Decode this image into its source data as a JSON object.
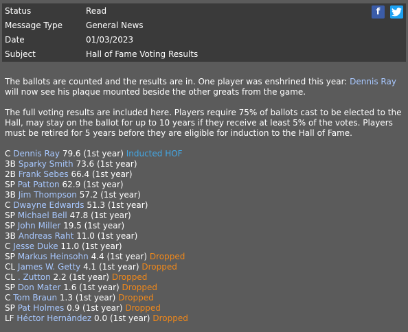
{
  "header": {
    "rows": [
      {
        "key": "Status",
        "value": "Read"
      },
      {
        "key": "Message Type",
        "value": "General News"
      },
      {
        "key": "Date",
        "value": "01/03/2023"
      },
      {
        "key": "Subject",
        "value": "Hall of Fame Voting Results"
      }
    ],
    "facebook_glyph": "f",
    "twitter_glyph": "t"
  },
  "message": {
    "p1_prefix": "The ballots are counted and the results are in. One player was enshrined this year: ",
    "p1_link": "Dennis Ray",
    "p1_suffix": " will now see his plaque mounted beside the other greats from the game.",
    "p2": "The full voting results are included here. Players require 75% of ballots cast to be elected to the Hall, may stay on the ballot for up to 10 years if they receive at least 5% of the votes.  Players must be retired for 5 years before they are eligible for induction to the Hall of Fame."
  },
  "players": [
    {
      "pos": "C",
      "name": "Dennis Ray",
      "stat": "79.6 (1st year)",
      "status": "Inducted HOF",
      "status_type": "hof"
    },
    {
      "pos": "3B",
      "name": "Sparky Smith",
      "stat": "73.6 (1st year)",
      "status": "",
      "status_type": ""
    },
    {
      "pos": "2B",
      "name": "Frank Sebes",
      "stat": "66.4 (1st year)",
      "status": "",
      "status_type": ""
    },
    {
      "pos": "SP",
      "name": "Pat Patton",
      "stat": "62.9 (1st year)",
      "status": "",
      "status_type": ""
    },
    {
      "pos": "3B",
      "name": "Jim Thompson",
      "stat": "57.2 (1st year)",
      "status": "",
      "status_type": ""
    },
    {
      "pos": "C",
      "name": "Dwayne Edwards",
      "stat": "51.3 (1st year)",
      "status": "",
      "status_type": ""
    },
    {
      "pos": "SP",
      "name": "Michael Bell",
      "stat": "47.8 (1st year)",
      "status": "",
      "status_type": ""
    },
    {
      "pos": "SP",
      "name": "John Miller",
      "stat": "19.5 (1st year)",
      "status": "",
      "status_type": ""
    },
    {
      "pos": "3B",
      "name": "Andreas Raht",
      "stat": "11.0 (1st year)",
      "status": "",
      "status_type": ""
    },
    {
      "pos": "C",
      "name": "Jesse Duke",
      "stat": "11.0 (1st year)",
      "status": "",
      "status_type": ""
    },
    {
      "pos": "SP",
      "name": "Markus Heinsohn",
      "stat": "4.4 (1st year)",
      "status": "Dropped",
      "status_type": "drop"
    },
    {
      "pos": "CL",
      "name": "James W. Getty",
      "stat": "4.1 (1st year)",
      "status": "Dropped",
      "status_type": "drop"
    },
    {
      "pos": "CL",
      "name": ". Zutton",
      "stat": "2.2 (1st year)",
      "status": "Dropped",
      "status_type": "drop"
    },
    {
      "pos": "SP",
      "name": "Don Mater",
      "stat": "1.6 (1st year)",
      "status": "Dropped",
      "status_type": "drop"
    },
    {
      "pos": "C",
      "name": "Tom Braun",
      "stat": "1.3 (1st year)",
      "status": "Dropped",
      "status_type": "drop"
    },
    {
      "pos": "SP",
      "name": "Pat Holmes",
      "stat": "0.9 (1st year)",
      "status": "Dropped",
      "status_type": "drop"
    },
    {
      "pos": "LF",
      "name": "Héctor Hernández",
      "stat": "0.0 (1st year)",
      "status": "Dropped",
      "status_type": "drop"
    }
  ]
}
